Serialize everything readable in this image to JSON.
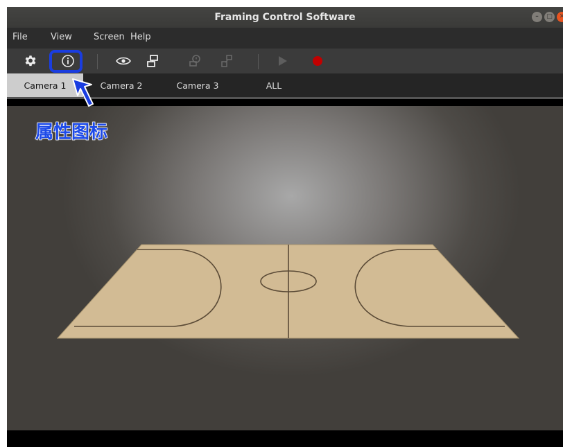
{
  "window": {
    "title": "Framing Control Software",
    "controls": [
      "minimize",
      "maximize",
      "close"
    ]
  },
  "menu": [
    "File",
    "View",
    "Screen",
    "Help"
  ],
  "toolbar": {
    "buttons": [
      {
        "icon": "gear-icon",
        "enabled": true
      },
      {
        "icon": "info-icon",
        "enabled": true,
        "highlighted": true
      },
      {
        "icon": "eye-icon",
        "enabled": true
      },
      {
        "icon": "layout-icon",
        "enabled": true
      },
      {
        "icon": "history-icon",
        "enabled": false
      },
      {
        "icon": "resize-icon",
        "enabled": false
      },
      {
        "icon": "play-icon",
        "enabled": false
      },
      {
        "icon": "record-icon",
        "enabled": true
      }
    ]
  },
  "tabs": [
    "Camera 1",
    "Camera 2",
    "Camera 3",
    "ALL"
  ],
  "active_tab": "Camera 1",
  "annotation": {
    "text": "属性图标",
    "color": "#1d4ae8"
  },
  "court": {
    "floor_color": "#d2bb94",
    "line_color": "#5a4a36"
  }
}
